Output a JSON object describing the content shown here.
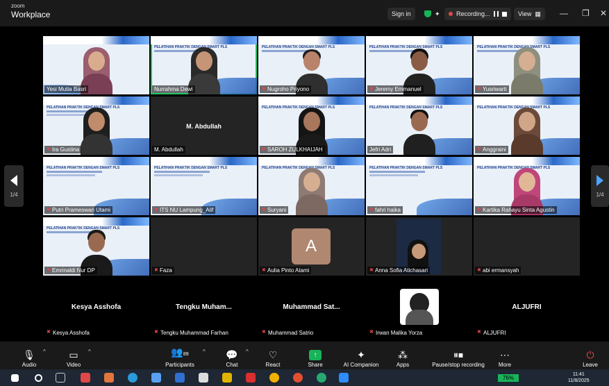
{
  "app": {
    "brand_top": "zoom",
    "brand_bottom": "Workplace"
  },
  "titlebar": {
    "sign_in": "Sign in",
    "recording": "Recording...",
    "view": "View",
    "minimize": "—",
    "maximize": "❐",
    "close": "✕"
  },
  "slide": {
    "title": "PELATIHAN PRAKTIK DENGAN SMART PLS"
  },
  "tiles": {
    "r1": [
      "Yesi Mutia Basri",
      "Nurrahma Dewi",
      "Nugroho Priyono",
      "Jeremy Emmanuel",
      "Yusriwarti"
    ],
    "r2": [
      "Ira Gustina",
      "M. Abdullah",
      "SAROH ZULKHAIJAH",
      "Jefri Adri",
      "Anggraini"
    ],
    "r2_big": "M. Abdullah",
    "r3": [
      "Putri Prameswari Utami",
      "ITS NU Lampung_Alif",
      "Suryani",
      "fahri haika",
      "Kartika Rahayu Sinta Agustin"
    ],
    "r4": [
      "Emrinaldi Nur DP",
      "Faza",
      "Aulia Pinto Atami",
      "Anna Sofia Atichasari",
      "abi ermansyah"
    ],
    "avatar_letter": "A"
  },
  "bottom_row": {
    "big": [
      "Kesya Asshofa",
      "Tengku Muham...",
      "Muhammad Sat...",
      "",
      "ALJUFRI"
    ],
    "tags": [
      "Kesya Asshofa",
      "Tengku Muhammad Farhan",
      "Muhammad Satrio",
      "Irwan Malika Yorza",
      "ALJUFRI"
    ]
  },
  "pager": {
    "left": "1/4",
    "right": "1/4"
  },
  "toolbar": {
    "audio": "Audio",
    "video": "Video",
    "participants": "Participants",
    "participants_count": "89",
    "chat": "Chat",
    "react": "React",
    "share": "Share",
    "ai": "AI Companion",
    "apps": "Apps",
    "record": "Pause/stop recording",
    "more": "More",
    "leave": "Leave"
  },
  "taskbar": {
    "battery": "76%",
    "time": "11:41",
    "date": "11/8/2025"
  },
  "colors": {
    "accent_green": "#19b35a",
    "recording_red": "#e04848",
    "slide_blue": "#2a68c8"
  }
}
